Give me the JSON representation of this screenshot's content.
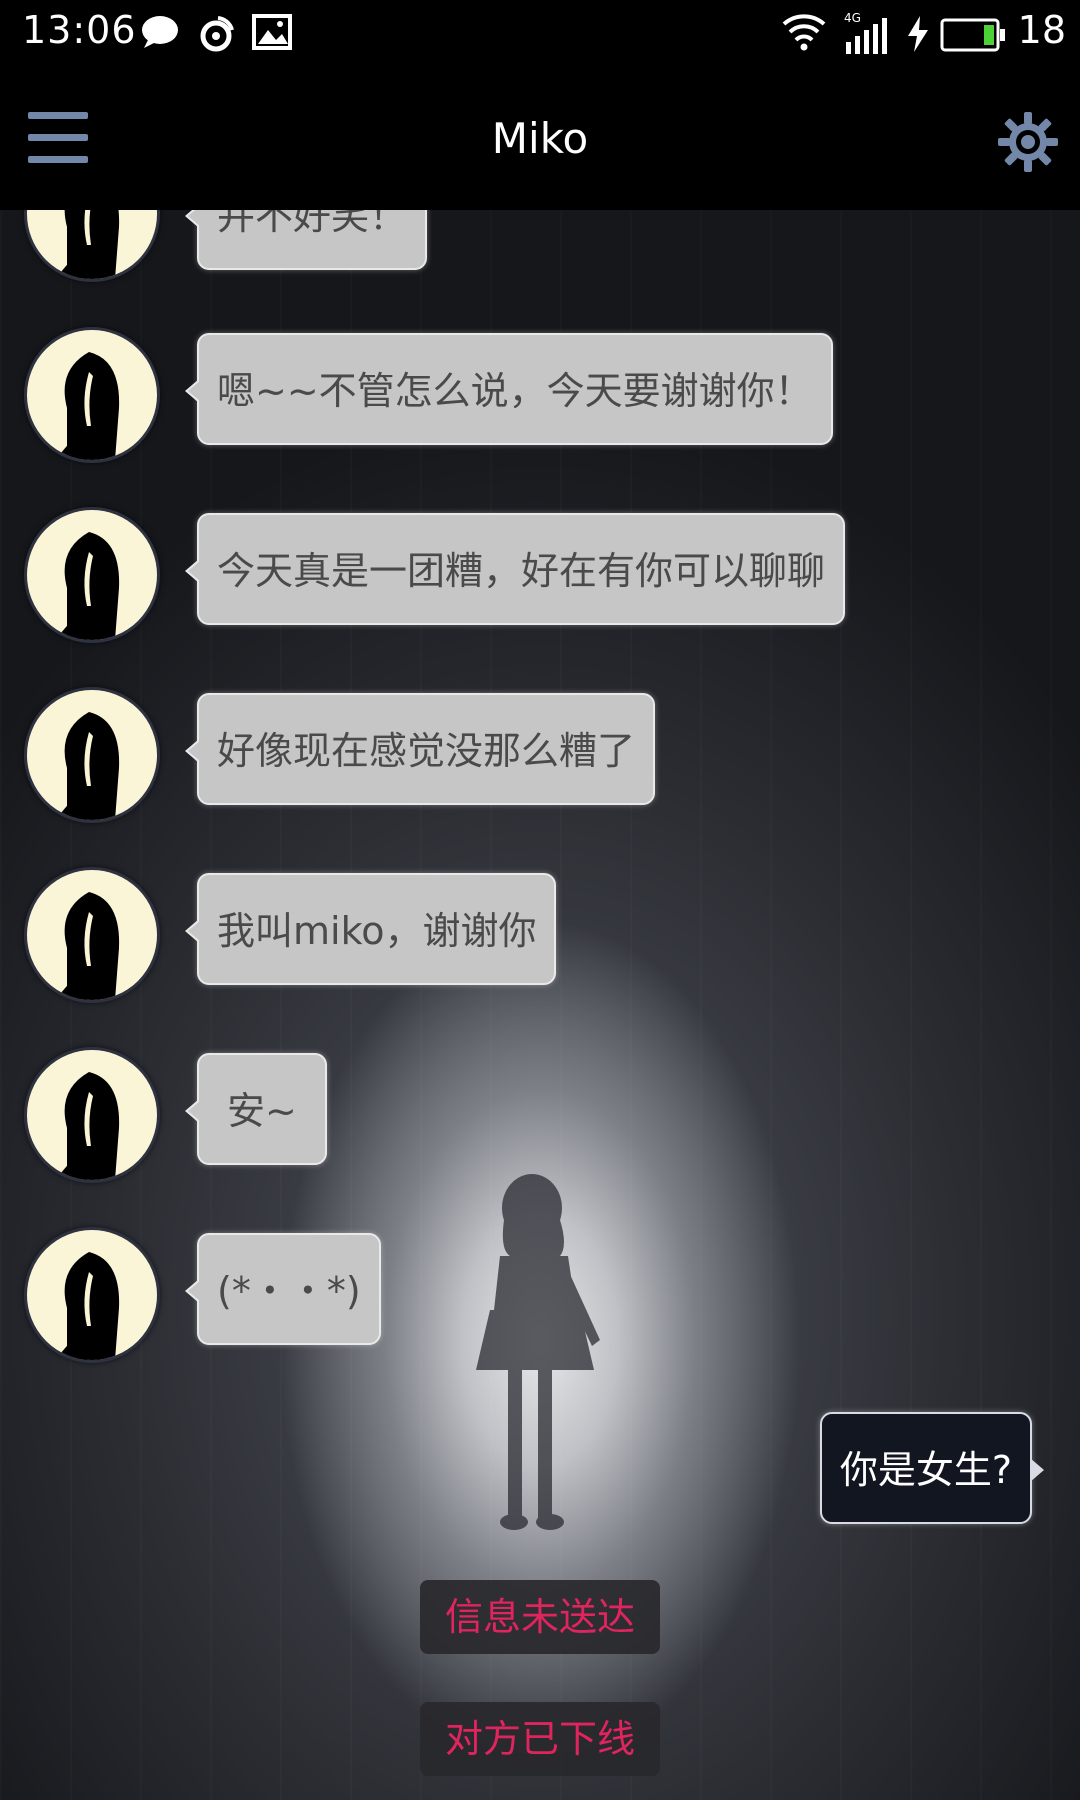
{
  "status_bar": {
    "time": "13:06",
    "network": "4G",
    "battery": "18",
    "icons": [
      "chat-bubble-icon",
      "weibo-icon",
      "image-icon",
      "wifi-icon",
      "signal-icon",
      "charging-icon",
      "battery-icon"
    ]
  },
  "app_bar": {
    "title": "Miko",
    "menu_icon": "menu-icon",
    "settings_icon": "gear-icon"
  },
  "messages": [
    {
      "from": "miko",
      "text": "并不好笑！"
    },
    {
      "from": "miko",
      "text": "嗯~~不管怎么说，今天要谢谢你！"
    },
    {
      "from": "miko",
      "text": "今天真是一团糟，好在有你可以聊聊"
    },
    {
      "from": "miko",
      "text": "好像现在感觉没那么糟了"
    },
    {
      "from": "miko",
      "text": "我叫miko，谢谢你"
    },
    {
      "from": "miko",
      "text": "安~"
    },
    {
      "from": "miko",
      "text": "(*・・*)"
    },
    {
      "from": "me",
      "text": "你是女生?"
    }
  ],
  "system": {
    "not_delivered": "信息未送达",
    "offline": "对方已下线"
  },
  "colors": {
    "accent_red": "#e0245e",
    "icon_blue": "#7388a8",
    "bubble_gray": "#c6c6c6",
    "my_bubble": "#121621"
  }
}
